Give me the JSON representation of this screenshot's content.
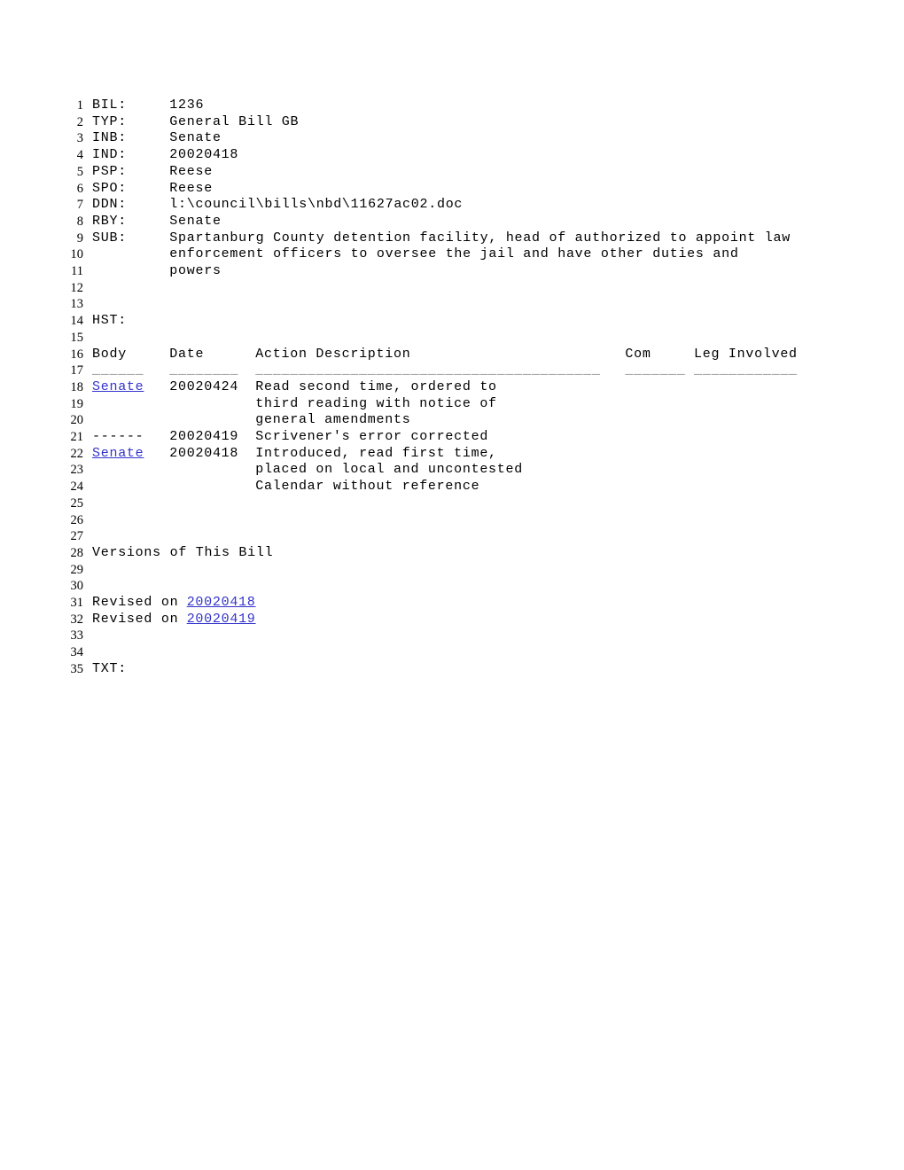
{
  "document": {
    "title": "Bill 1236 - General Bill GB",
    "link_color": "#3333cc",
    "text_color": "#000000"
  },
  "fields": [
    {
      "label": "BIL:",
      "value": "1236"
    },
    {
      "label": "TYP:",
      "value": "General Bill GB"
    },
    {
      "label": "INB:",
      "value": "Senate"
    },
    {
      "label": "IND:",
      "value": "20020418"
    },
    {
      "label": "PSP:",
      "value": "Reese"
    },
    {
      "label": "SPO:",
      "value": "Reese"
    },
    {
      "label": "DDN:",
      "value": "l:\\council\\bills\\nbd\\11627ac02.doc"
    },
    {
      "label": "RBY:",
      "value": "Senate"
    },
    {
      "label": "SUB:",
      "value": "Spartanburg County detention facility, head of authorized to appoint law"
    }
  ],
  "subject_continuation": [
    "enforcement officers to oversee the jail and have other duties and",
    "powers"
  ],
  "history": {
    "label": "HST:",
    "columns": [
      "Body",
      "Date",
      "Action Description",
      "Com",
      "Leg Involved"
    ],
    "rules": [
      "______",
      "________",
      "________________________________________",
      "_______",
      "____________"
    ],
    "rows": [
      {
        "body": "Senate",
        "body_is_link": true,
        "date": "20020424",
        "action_lines": [
          "Read second time, ordered to",
          "third reading with notice of",
          "general amendments"
        ],
        "com": "",
        "leg_involved": ""
      },
      {
        "body": "------",
        "body_is_link": false,
        "date": "20020419",
        "action_lines": [
          "Scrivener's error corrected"
        ],
        "com": "",
        "leg_involved": ""
      },
      {
        "body": "Senate",
        "body_is_link": true,
        "date": "20020418",
        "action_lines": [
          "Introduced, read first time,",
          "placed on local and uncontested",
          "Calendar without reference"
        ],
        "com": "",
        "leg_involved": ""
      }
    ]
  },
  "versions": {
    "heading": "Versions of This Bill",
    "items": [
      {
        "prefix": "Revised on ",
        "date": "20020418"
      },
      {
        "prefix": "Revised on ",
        "date": "20020419"
      }
    ]
  },
  "text_section": {
    "label": "TXT:"
  },
  "line_numbers": [
    "1",
    "2",
    "3",
    "4",
    "5",
    "6",
    "7",
    "8",
    "9",
    "10",
    "11",
    "12",
    "13",
    "14",
    "15",
    "16",
    "17",
    "18",
    "19",
    "20",
    "21",
    "22",
    "23",
    "24",
    "25",
    "26",
    "27",
    "28",
    "29",
    "30",
    "31",
    "32",
    "33",
    "34",
    "35"
  ]
}
